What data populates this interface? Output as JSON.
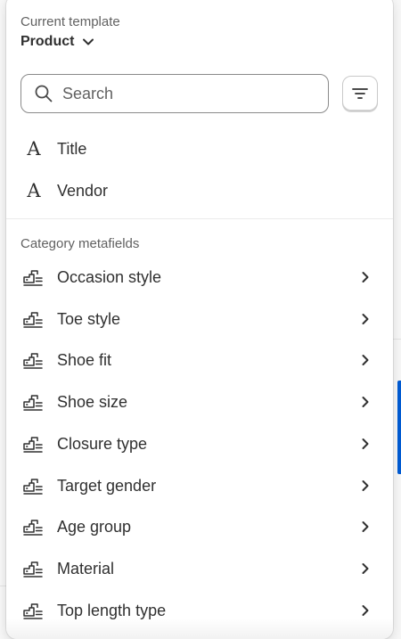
{
  "template": {
    "label": "Current template",
    "value": "Product"
  },
  "search": {
    "placeholder": "Search",
    "value": ""
  },
  "fields": [
    {
      "label": "Title",
      "icon": "text-icon"
    },
    {
      "label": "Vendor",
      "icon": "text-icon"
    }
  ],
  "category_section": {
    "label": "Category metafields",
    "items": [
      {
        "label": "Occasion style"
      },
      {
        "label": "Toe style"
      },
      {
        "label": "Shoe fit"
      },
      {
        "label": "Shoe size"
      },
      {
        "label": "Closure type"
      },
      {
        "label": "Target gender"
      },
      {
        "label": "Age group"
      },
      {
        "label": "Material"
      },
      {
        "label": "Top length type"
      }
    ]
  },
  "icons": {
    "text_glyph": "A",
    "metafield": "metafield-list-icon",
    "chevron": "chevron-right-icon"
  },
  "colors": {
    "accent": "#005bd3",
    "text": "#303030",
    "subdued": "#616161"
  }
}
